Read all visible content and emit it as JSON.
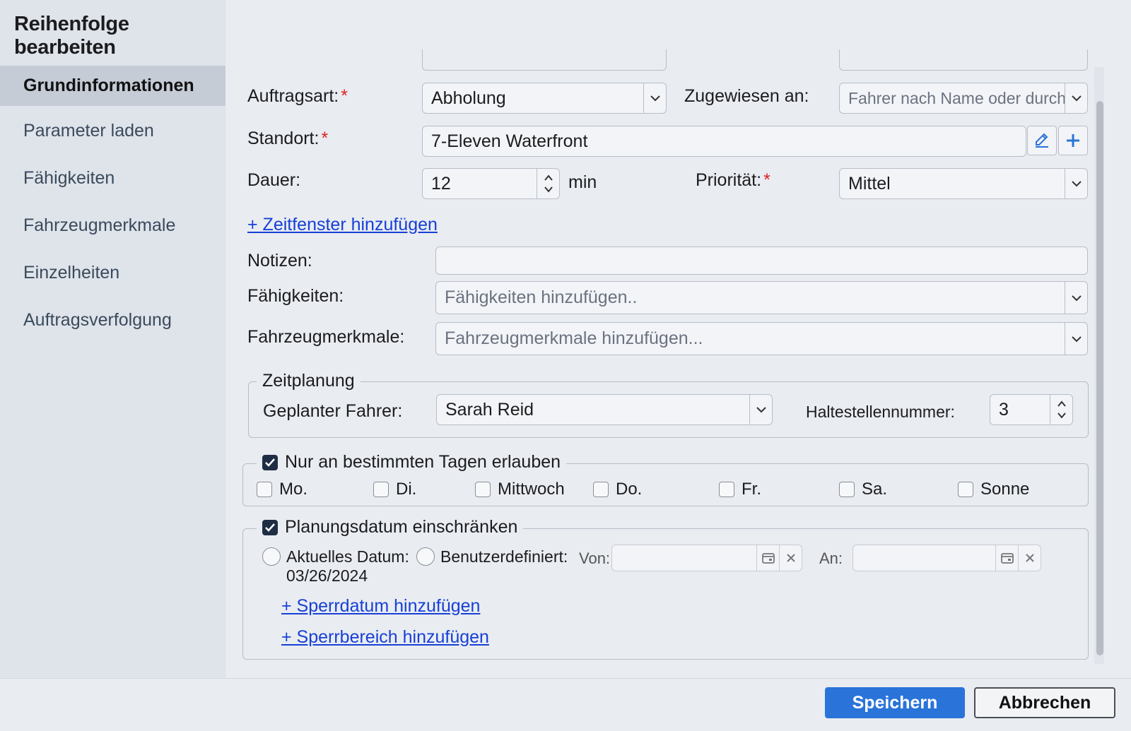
{
  "dialog": {
    "title": "Reihenfolge bearbeiten"
  },
  "sidebar": {
    "items": [
      {
        "label": "Grundinformationen"
      },
      {
        "label": "Parameter laden"
      },
      {
        "label": "Fähigkeiten"
      },
      {
        "label": "Fahrzeugmerkmale"
      },
      {
        "label": "Einzelheiten"
      },
      {
        "label": "Auftragsverfolgung"
      }
    ]
  },
  "form": {
    "auftragsart": {
      "label": "Auftragsart:",
      "required": "*",
      "value": "Abholung"
    },
    "zugewiesen": {
      "label": "Zugewiesen an:",
      "placeholder": "Fahrer nach Name oder durchsuchen"
    },
    "standort": {
      "label": "Standort:",
      "required": "*",
      "value": "7-Eleven Waterfront"
    },
    "dauer": {
      "label": "Dauer:",
      "value": "12",
      "unit": "min"
    },
    "prioritaet": {
      "label": "Priorität:",
      "required": "*",
      "value": "Mittel"
    },
    "zeitfenster_link": "+ Zeitfenster hinzufügen",
    "notizen": {
      "label": "Notizen:",
      "value": ""
    },
    "faehigkeiten": {
      "label": "Fähigkeiten:",
      "placeholder": "Fähigkeiten hinzufügen.."
    },
    "fahrzeugmerkmale": {
      "label": "Fahrzeugmerkmale:",
      "placeholder": "Fahrzeugmerkmale hinzufügen..."
    }
  },
  "zeitplanung": {
    "legend": "Zeitplanung",
    "fahrer_label": "Geplanter Fahrer:",
    "fahrer_value": "Sarah Reid",
    "halt_label": "Haltestellennummer:",
    "halt_value": "3"
  },
  "tage": {
    "legend": "Nur an bestimmten Tagen erlauben",
    "checked": true,
    "days": [
      {
        "label": "Mo.",
        "checked": false
      },
      {
        "label": "Di.",
        "checked": false
      },
      {
        "label": "Mittwoch",
        "checked": false
      },
      {
        "label": "Do.",
        "checked": false
      },
      {
        "label": "Fr.",
        "checked": false
      },
      {
        "label": "Sa.",
        "checked": false
      },
      {
        "label": "Sonne",
        "checked": false
      }
    ]
  },
  "planungsdatum": {
    "legend": "Planungsdatum einschränken",
    "checked": true,
    "aktuell_label": "Aktuelles Datum:",
    "aktuell_date": "03/26/2024",
    "benutzer_label": "Benutzerdefiniert:",
    "von_label": "Von:",
    "an_label": "An:",
    "sperrdatum_link": "+ Sperrdatum hinzufügen",
    "sperrbereich_link": "+ Sperrbereich hinzufügen"
  },
  "footer": {
    "save_label": "Speichern",
    "cancel_label": "Abbrechen"
  },
  "colors": {
    "primary": "#2a73d9",
    "link": "#1740d6",
    "required": "#e02020",
    "checkbox": "#1f2d44"
  }
}
